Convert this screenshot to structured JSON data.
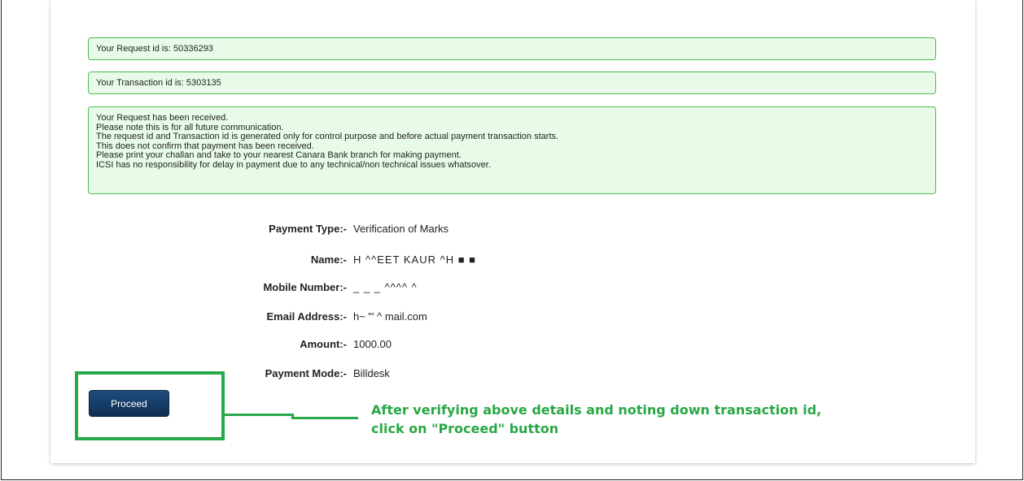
{
  "alerts": {
    "request_id_text": "Your Request id is: 50336293",
    "transaction_id_text": "Your Transaction id is: 5303135",
    "notice_lines": [
      "Your Request has been received.",
      "Please note this is for all future communication.",
      "The request id and Transaction id is generated only for control purpose and before actual payment transaction starts.",
      "This does not confirm that payment has been received.",
      "Please print your challan and take to your nearest Canara Bank branch for making payment.",
      "ICSI has no responsibility for delay in payment due to any technical/non technical issues whatsover."
    ]
  },
  "details": [
    {
      "label": "Payment Type:-",
      "value": "Verification of Marks"
    },
    {
      "label": "Name:-",
      "value": "H       ^^EET KAUR ^H    ■ ■"
    },
    {
      "label": "Mobile Number:-",
      "value": "_ _ _     ^^^^ ^"
    },
    {
      "label": "Email Address:-",
      "value": "h~     \"'  ^  mail.com"
    },
    {
      "label": "Amount:-",
      "value": "1000.00"
    },
    {
      "label": "Payment Mode:-",
      "value": "Billdesk"
    }
  ],
  "proceed_button": {
    "label": "Proceed"
  },
  "annotation": {
    "line1": "After verifying above details and noting down transaction id,",
    "line2": "click on \"Proceed\" button"
  },
  "colors": {
    "alert_bg": "#e8fbe8",
    "alert_border": "#4cbd4c",
    "button_bg": "#163d66",
    "annotation_green": "#29a745"
  }
}
